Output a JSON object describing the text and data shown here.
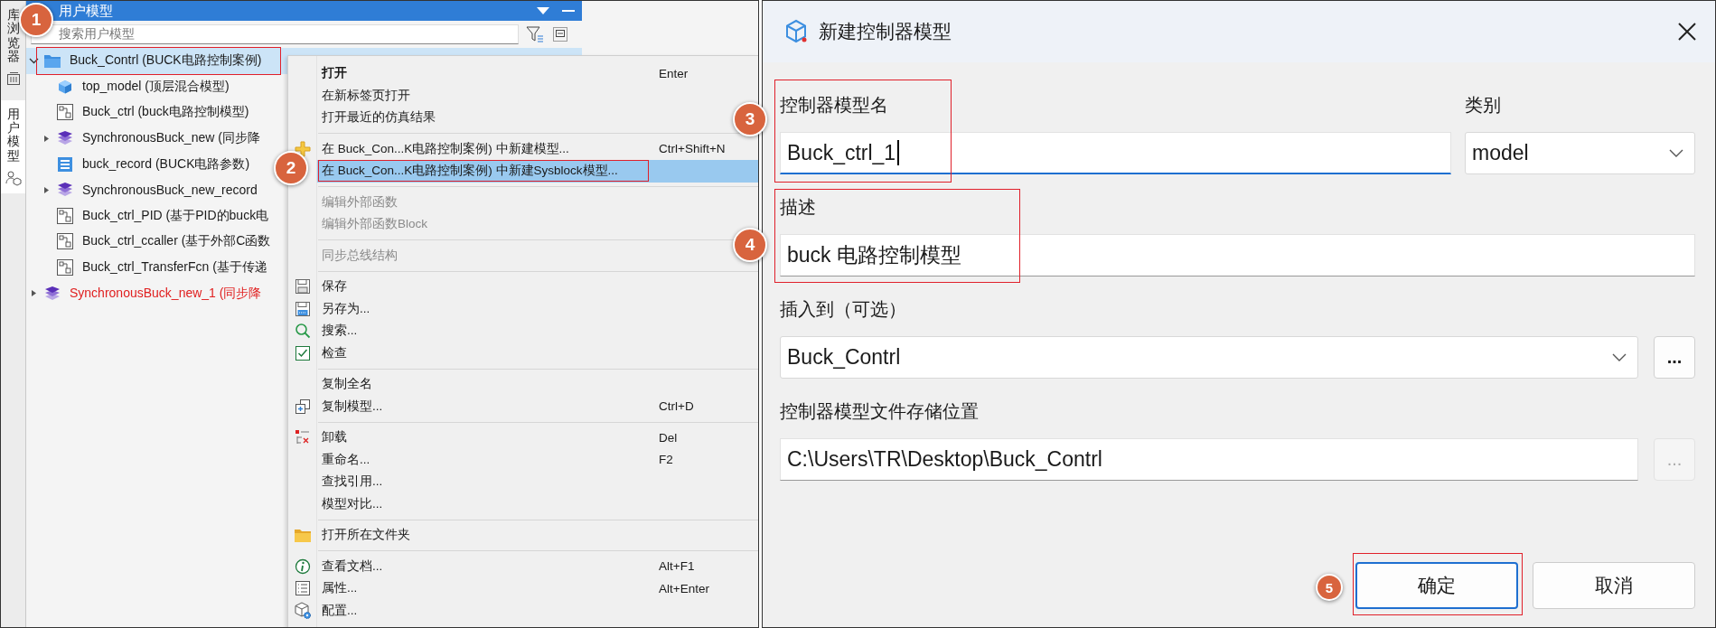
{
  "side_tabs": [
    {
      "label": "库浏览器",
      "selected": false
    },
    {
      "label": "用户模型",
      "selected": true
    }
  ],
  "user_models": {
    "title": "用户模型",
    "search": {
      "placeholder": "搜索用户模型"
    },
    "tree": [
      {
        "label": "Buck_Contrl (BUCK电路控制案例)",
        "kind": "folder",
        "selected": true,
        "expanded": true,
        "color": "#1a1a1a",
        "children": [
          {
            "label": "top_model (顶层混合模型)",
            "kind": "cube",
            "selected": false,
            "color": "#1a1a1a"
          },
          {
            "label": "Buck_ctrl (buck电路控制模型)",
            "kind": "diagram",
            "selected": false,
            "color": "#1a1a1a"
          },
          {
            "label": "SynchronousBuck_new (同步降",
            "kind": "layers",
            "selected": false,
            "expanded": false,
            "color": "#1a1a1a"
          },
          {
            "label": "buck_record (BUCK电路参数)",
            "kind": "record",
            "selected": false,
            "color": "#1a1a1a"
          },
          {
            "label": "SynchronousBuck_new_record",
            "kind": "layers",
            "selected": false,
            "expanded": false,
            "color": "#1a1a1a"
          },
          {
            "label": "Buck_ctrl_PID (基于PID的buck电",
            "kind": "diagram",
            "selected": false,
            "color": "#1a1a1a"
          },
          {
            "label": "Buck_ctrl_ccaller (基于外部C函数",
            "kind": "diagram",
            "selected": false,
            "color": "#1a1a1a"
          },
          {
            "label": "Buck_ctrl_TransferFcn (基于传递",
            "kind": "diagram",
            "selected": false,
            "color": "#1a1a1a"
          }
        ]
      },
      {
        "label": "SynchronousBuck_new_1 (同步降",
        "kind": "layers",
        "selected": false,
        "expanded": false,
        "color": "#e02020"
      }
    ]
  },
  "context_menu": {
    "groups": [
      [
        {
          "label": "打开",
          "shortcut": "Enter",
          "default": true,
          "disabled": false,
          "selected": false
        },
        {
          "label": "在新标签页打开",
          "default": false,
          "disabled": false,
          "selected": false
        },
        {
          "label": "打开最近的仿真结果",
          "default": false,
          "disabled": false,
          "selected": false
        }
      ],
      [
        {
          "label": "在 Buck_Con...K电路控制案例) 中新建模型...",
          "shortcut": "Ctrl+Shift+N",
          "default": false,
          "disabled": false,
          "selected": false
        },
        {
          "label": "在 Buck_Con...K电路控制案例) 中新建Sysblock模型...",
          "default": false,
          "disabled": false,
          "selected": true
        }
      ],
      [
        {
          "label": "编辑外部函数",
          "default": false,
          "disabled": true,
          "selected": false
        },
        {
          "label": "编辑外部函数Block",
          "default": false,
          "disabled": true,
          "selected": false
        }
      ],
      [
        {
          "label": "同步总线结构",
          "default": false,
          "disabled": true,
          "selected": false
        }
      ],
      [
        {
          "label": "保存",
          "default": false,
          "disabled": false,
          "selected": false
        },
        {
          "label": "另存为...",
          "default": false,
          "disabled": false,
          "selected": false
        },
        {
          "label": "搜索...",
          "default": false,
          "disabled": false,
          "selected": false
        },
        {
          "label": "检查",
          "default": false,
          "disabled": false,
          "selected": false
        }
      ],
      [
        {
          "label": "复制全名",
          "default": false,
          "disabled": false,
          "selected": false
        },
        {
          "label": "复制模型...",
          "shortcut": "Ctrl+D",
          "default": false,
          "disabled": false,
          "selected": false
        }
      ],
      [
        {
          "label": "卸载",
          "shortcut": "Del",
          "default": false,
          "disabled": false,
          "selected": false
        },
        {
          "label": "重命名...",
          "shortcut": "F2",
          "default": false,
          "disabled": false,
          "selected": false
        },
        {
          "label": "查找引用...",
          "default": false,
          "disabled": false,
          "selected": false
        },
        {
          "label": "模型对比...",
          "default": false,
          "disabled": false,
          "selected": false
        }
      ],
      [
        {
          "label": "打开所在文件夹",
          "default": false,
          "disabled": false,
          "selected": false
        }
      ],
      [
        {
          "label": "查看文档...",
          "shortcut": "Alt+F1",
          "default": false,
          "disabled": false,
          "selected": false
        },
        {
          "label": "属性...",
          "shortcut": "Alt+Enter",
          "default": false,
          "disabled": false,
          "selected": false
        },
        {
          "label": "配置...",
          "default": false,
          "disabled": false,
          "selected": false
        }
      ]
    ]
  },
  "dialog": {
    "title": "新建控制器模型",
    "fields": [
      {
        "label": "控制器模型名",
        "kind": "text",
        "value": "Buck_ctrl_1",
        "focused": true
      },
      {
        "label": "类别",
        "kind": "select",
        "value": "model"
      },
      {
        "label": "描述",
        "kind": "text",
        "value": "buck 电路控制模型",
        "focused": false
      },
      {
        "label": "插入到（可选）",
        "kind": "select",
        "value": "Buck_Contrl",
        "browse": {
          "label": "...",
          "disabled": false
        }
      },
      {
        "label": "控制器模型文件存储位置",
        "kind": "text",
        "value": "C:\\Users\\TR\\Desktop\\Buck_Contrl",
        "focused": false,
        "browse": {
          "label": "...",
          "disabled": true
        }
      }
    ],
    "buttons": [
      {
        "label": "确定",
        "default": true
      },
      {
        "label": "取消",
        "default": false
      }
    ]
  },
  "annotations": [
    {
      "label": "1"
    },
    {
      "label": "2"
    },
    {
      "label": "3"
    },
    {
      "label": "4"
    },
    {
      "label": "5"
    }
  ]
}
